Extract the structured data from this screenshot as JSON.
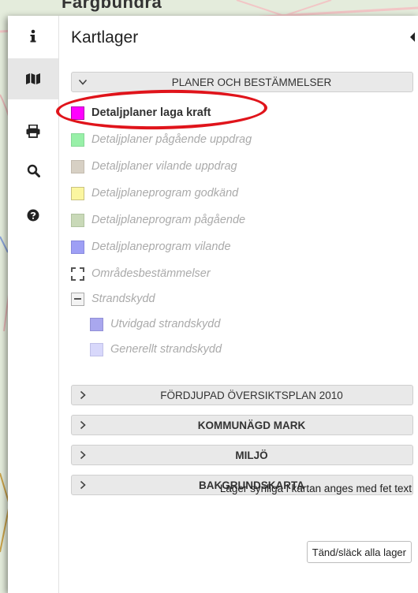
{
  "map": {
    "place_label": "Färgbundra"
  },
  "panel": {
    "title": "Kartlager",
    "sidebar": [
      {
        "icon": "info-icon",
        "active": false
      },
      {
        "icon": "map-icon",
        "active": true
      },
      {
        "icon": "print-icon",
        "active": false
      },
      {
        "icon": "search-icon",
        "active": false
      },
      {
        "icon": "help-icon",
        "active": false
      }
    ],
    "groups": [
      {
        "label": "PLANER OCH BESTÄMMELSER",
        "expanded": true,
        "layers": [
          {
            "label": "Detaljplaner laga kraft",
            "visible": true,
            "color": "#ff00ff"
          },
          {
            "label": "Detaljplaner pågående uppdrag",
            "visible": false,
            "color": "#98f0a8"
          },
          {
            "label": "Detaljplaner vilande uppdrag",
            "visible": false,
            "color": "#d7d0c4"
          },
          {
            "label": "Detaljplaneprogram godkänd",
            "visible": false,
            "color": "#fbf6a0"
          },
          {
            "label": "Detaljplaneprogram pågående",
            "visible": false,
            "color": "#c9d9b8"
          },
          {
            "label": "Detaljplaneprogram vilande",
            "visible": false,
            "color": "#9e9ff5"
          },
          {
            "label": "Områdesbestämmelser",
            "visible": false,
            "color": "dashed"
          },
          {
            "label": "Strandskydd",
            "visible": false,
            "color": "collapse"
          },
          {
            "label": "Utvidgad strandskydd",
            "visible": false,
            "color": "#a9a7ee"
          },
          {
            "label": "Generellt strandskydd",
            "visible": false,
            "color": "#d8d8fb"
          }
        ]
      },
      {
        "label": "FÖRDJUPAD ÖVERSIKTSPLAN 2010",
        "expanded": false
      },
      {
        "label": "KOMMUNÄGD MARK",
        "expanded": false
      },
      {
        "label": "MILJÖ",
        "expanded": false
      },
      {
        "label": "BAKGRUNDSKARTA",
        "expanded": false
      }
    ],
    "footer_note": "Lager synliga i kartan anges med fet text",
    "toggle_all_label": "Tänd/släck alla lager"
  },
  "accent_colors": {
    "highlight_ring": "#e0141b",
    "visible_swatch": "#ff00ff"
  }
}
